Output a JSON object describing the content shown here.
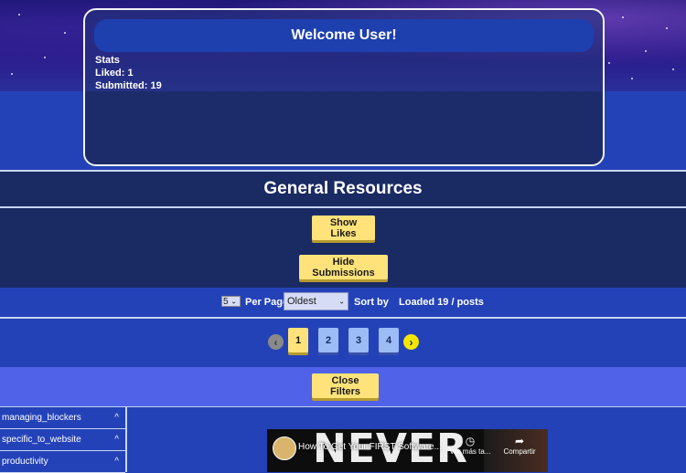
{
  "header": {
    "welcome": "Welcome User!",
    "stats_title": "Stats",
    "liked": "Liked: 1",
    "submitted": "Submitted: 19"
  },
  "section": {
    "title": "General Resources",
    "show_likes": "Show Likes",
    "hide_submissions": "Hide Submissions",
    "close_filters": "Close Filters"
  },
  "controls": {
    "per_page_value": "5",
    "per_page_label": "Per Page",
    "sort_value": "Oldest",
    "sort_label": "Sort by",
    "loaded": "Loaded 19 / posts"
  },
  "pagination": {
    "pages": [
      "1",
      "2",
      "3",
      "4"
    ],
    "active": "1",
    "prev_icon": "chevron-left-icon",
    "next_icon": "chevron-right-icon"
  },
  "sidebar": {
    "items": [
      {
        "label": "managing_blockers",
        "icon": "chevron-up-icon"
      },
      {
        "label": "specific_to_website",
        "icon": "chevron-up-icon"
      },
      {
        "label": "productivity",
        "icon": "chevron-up-icon"
      }
    ]
  },
  "video": {
    "title": "How To Get Your FIRST Software...",
    "thumbnail_text": "NEVER",
    "watch_later": "Ver más ta...",
    "share": "Compartir"
  },
  "colors": {
    "page_bg": "#2442b8",
    "dark_band": "#1a2a63",
    "button_yellow": "#ffe37a",
    "filters_band": "#5063e8",
    "page_inactive": "#9bbcf5"
  }
}
